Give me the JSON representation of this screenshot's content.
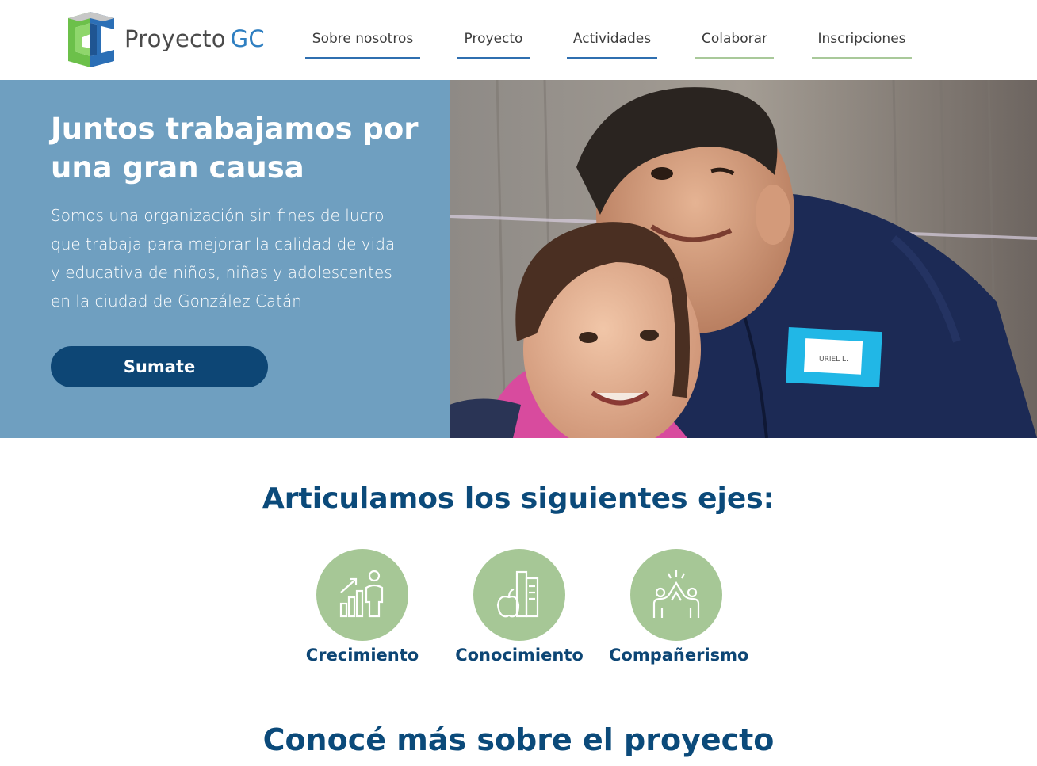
{
  "header": {
    "brand_main": "Proyecto",
    "brand_accent": "GC",
    "nav": [
      {
        "label": "Sobre nosotros"
      },
      {
        "label": "Proyecto"
      },
      {
        "label": "Actividades"
      },
      {
        "label": "Colaborar"
      },
      {
        "label": "Inscripciones"
      }
    ]
  },
  "hero": {
    "title": "Juntos trabajamos por una gran causa",
    "text": "Somos una organización sin fines de lucro que trabaja para mejorar la calidad de vida y educativa de niños, niñas y adolescentes en la ciudad de González Catán",
    "button_label": "Sumate",
    "badge_text": "URIEL L."
  },
  "ejes": {
    "title": "Articulamos los siguientes ejes:",
    "items": [
      {
        "label": "Crecimiento",
        "icon": "growth-chart-icon"
      },
      {
        "label": "Conocimiento",
        "icon": "books-apple-icon"
      },
      {
        "label": "Compañerismo",
        "icon": "high-five-icon"
      }
    ]
  },
  "more": {
    "title": "Conocé más sobre el proyecto"
  },
  "colors": {
    "nav_underline_blue": "#2f6fb0",
    "nav_underline_green": "#a9c99a",
    "hero_panel": "#6f9fc0",
    "primary_dark": "#0d4675",
    "eje_circle": "#a6c796"
  }
}
